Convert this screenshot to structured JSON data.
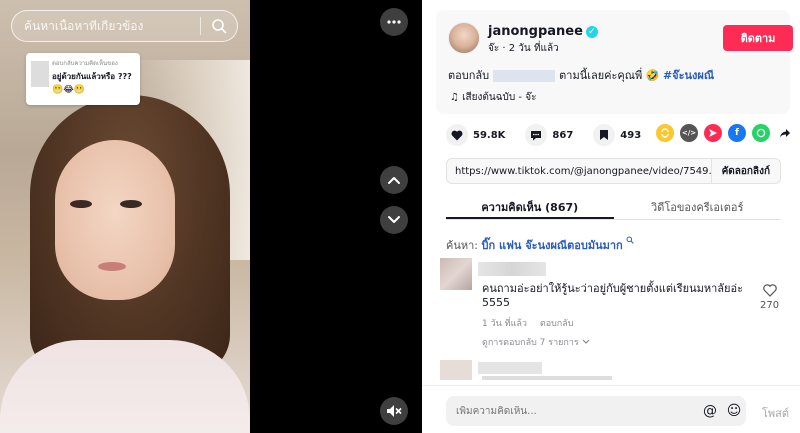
{
  "video": {
    "search_placeholder": "ค้นหาเนื้อหาที่เกี่ยวข้อง",
    "reply_card": {
      "header": "ตอบกลับความคิดเห็นของ",
      "text": "อยู่ด้วยกันแล้วหรือ ???",
      "emoji": "😬😂😬"
    },
    "more_icon": "more-horizontal-icon",
    "up_icon": "chevron-up-icon",
    "down_icon": "chevron-down-icon",
    "mute_icon": "volume-mute-icon"
  },
  "author": {
    "username": "janongpanee",
    "verified_mark": "✓",
    "meta": "จ๊ะ · 2 วัน ที่แล้ว",
    "follow_label": "ติดตาม",
    "caption_prefix": "ตอบกลับ",
    "caption_suffix": "ตามนี้เลยค่ะคุณพี่ 🤣",
    "hashtag": "#จ๊ะนงผณี",
    "music": "♫  เสียงต้นฉบับ - จ๊ะ"
  },
  "actions": {
    "likes": "59.8K",
    "comments": "867",
    "saves": "493"
  },
  "share": {
    "embed_glyph": "</>",
    "facebook_glyph": "f"
  },
  "link": {
    "url": "https://www.tiktok.com/@janongpanee/video/7549...",
    "copy_label": "คัดลอกลิงก์"
  },
  "tabs": [
    {
      "label": "ความคิดเห็น (867)"
    },
    {
      "label": "วิดีโอของครีเอเตอร์"
    }
  ],
  "search_hint": {
    "prefix": "ค้นหา: ",
    "query": "บิ๊ก แฟน จ๊ะนงผณีตอบมันมาก"
  },
  "comments": [
    {
      "text": "คนถามอ่ะอย่าให้รู้นะว่าอยู่กับผู้ชายตั้งแต่เรียนมหาลัยอ่ะ 5555",
      "time": "1 วัน ที่แล้ว",
      "reply_label": "ตอบกลับ",
      "view_replies": "ดูการตอบกลับ 7 รายการ",
      "likes": "270"
    }
  ],
  "footer": {
    "comment_placeholder": "เพิ่มความคิดเห็น...",
    "mention_glyph": "@",
    "emoji_glyph": "☺",
    "post_label": "โพสต์"
  }
}
